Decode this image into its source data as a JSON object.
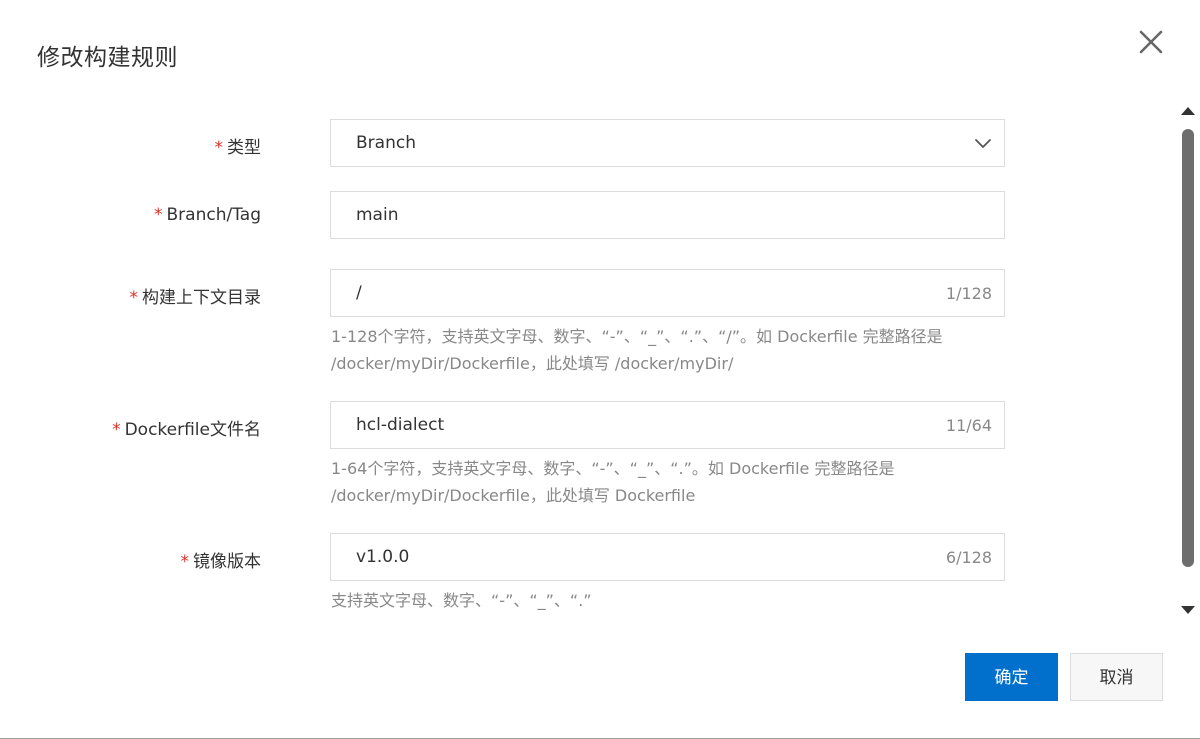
{
  "dialog": {
    "title": "修改构建规则",
    "close_icon": "close-icon"
  },
  "form": {
    "required_mark": "*",
    "type": {
      "label": "类型",
      "value": "Branch",
      "icon": "chevron-down-icon"
    },
    "branch_tag": {
      "label": "Branch/Tag",
      "value": "main"
    },
    "context_dir": {
      "label": "构建上下文目录",
      "value": "/",
      "counter": "1/128",
      "hint_line1": "1-128个字符，支持英文字母、数字、“-”、“_”、“.”、“/”。如 Dockerfile 完整路径是",
      "hint_line2": "/docker/myDir/Dockerfile，此处填写 /docker/myDir/"
    },
    "dockerfile_name": {
      "label": "Dockerfile文件名",
      "value": "hcl-dialect",
      "counter": "11/64",
      "hint_line1": "1-64个字符，支持英文字母、数字、“-”、“_”、“.”。如 Dockerfile 完整路径是",
      "hint_line2": "/docker/myDir/Dockerfile，此处填写 Dockerfile"
    },
    "image_version": {
      "label": "镜像版本",
      "value": "v1.0.0",
      "counter": "6/128",
      "hint": "支持英文字母、数字、“-”、“_”、“.”"
    }
  },
  "footer": {
    "confirm_label": "确定",
    "cancel_label": "取消"
  },
  "colors": {
    "primary": "#0070cc",
    "required": "#d93026",
    "hint": "#888888"
  }
}
